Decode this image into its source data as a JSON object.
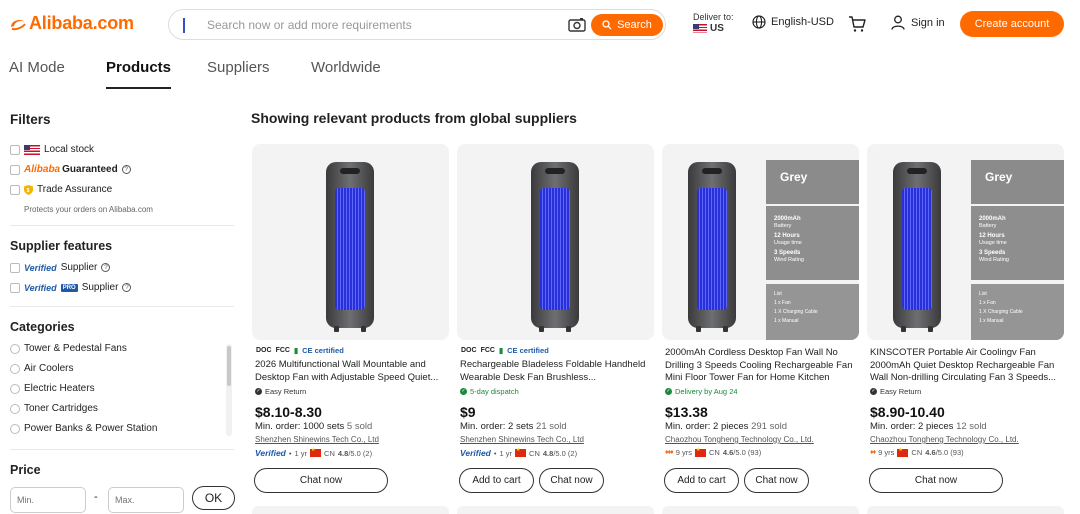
{
  "header": {
    "logo": "Alibaba.com",
    "search_placeholder": "Search now or add more requirements",
    "search_button": "Search",
    "deliver_label": "Deliver to:",
    "deliver_country": "US",
    "language": "English-USD",
    "signin": "Sign in",
    "create_account": "Create account"
  },
  "tabs": [
    "AI Mode",
    "Products",
    "Suppliers",
    "Worldwide"
  ],
  "sidebar": {
    "filters_title": "Filters",
    "local_stock": "Local stock",
    "guaranteed_brand": "Alibaba",
    "guaranteed_word": "Guaranteed",
    "trade_assurance": "Trade Assurance",
    "trade_note": "Protects your orders on Alibaba.com",
    "supplier_features_title": "Supplier features",
    "verified_word": "Verified",
    "pro_word": "PRO",
    "supplier_word": "Supplier",
    "categories_title": "Categories",
    "categories": [
      "Tower & Pedestal Fans",
      "Air Coolers",
      "Electric Heaters",
      "Toner Cartridges",
      "Power Banks & Power Station"
    ],
    "price_title": "Price",
    "min_placeholder": "Min.",
    "max_placeholder": "Max.",
    "dash": "-",
    "ok": "OK"
  },
  "main": {
    "heading": "Showing relevant products from global suppliers"
  },
  "products": [
    {
      "certs": [
        "DOC",
        "FCC",
        "CE certified"
      ],
      "title": "2026 Multifunctional Wall Mountable and Desktop Fan with Adjustable Speed Quiet...",
      "feature": "Easy Return",
      "price": "$8.10-8.30",
      "moq": "Min. order: 1000 sets",
      "sold": "5 sold",
      "supplier": "Shenzhen Shinewins Tech Co., Ltd",
      "badge": "Verified",
      "years": "1 yr",
      "country": "CN",
      "rating": "4.8",
      "rating_total": "/5.0 (2)",
      "buttons": [
        "Chat now"
      ]
    },
    {
      "certs": [
        "DOC",
        "FCC",
        "CE certified"
      ],
      "title": "Rechargeable Bladeless Foldable Handheld Wearable Desk Fan Brushless...",
      "feature": "5-day dispatch",
      "price": "$9",
      "moq": "Min. order: 2 sets",
      "sold": "21 sold",
      "supplier": "Shenzhen Shinewins Tech Co., Ltd",
      "badge": "Verified",
      "years": "1 yr",
      "country": "CN",
      "rating": "4.8",
      "rating_total": "/5.0 (2)",
      "buttons": [
        "Add to cart",
        "Chat now"
      ]
    },
    {
      "title": "2000mAh Cordless Desktop Fan Wall No Drilling 3 Speeds Cooling Rechargeable Fan Mini Floor Tower Fan for Home Kitchen",
      "feature": "Delivery by Aug 24",
      "price": "$13.38",
      "moq": "Min. order: 2 pieces",
      "sold": "291 sold",
      "supplier": "Chaozhou Tongheng Technology Co., Ltd.",
      "years": "9 yrs",
      "country": "CN",
      "rating": "4.6",
      "rating_total": "/5.0 (93)",
      "buttons": [
        "Add to cart",
        "Chat now"
      ]
    },
    {
      "title": "KINSCOTER Portable Air Coolingv Fan 2000mAh Quiet Desktop Rechargeable Fan Wall Non-drilling Circulating Fan 3 Speeds...",
      "feature": "Easy Return",
      "price": "$8.90-10.40",
      "moq": "Min. order: 2 pieces",
      "sold": "12 sold",
      "supplier": "Chaozhou Tongheng Technology Co., Ltd.",
      "years": "9 yrs",
      "country": "CN",
      "rating": "4.6",
      "rating_total": "/5.0 (93)",
      "buttons": [
        "Chat now"
      ]
    }
  ],
  "spec_image": {
    "color": "Grey",
    "battery_val": "2000mAh",
    "battery_lbl": "Battery",
    "hours_val": "12 Hours",
    "hours_lbl": "Usage time",
    "speeds_val": "3 Speeds",
    "speeds_lbl": "Wind Rating",
    "list_title": "List",
    "list_items": [
      "1 x Fan",
      "1 X Charging Cable",
      "1 x Manual"
    ]
  },
  "colors": {
    "brand": "#ff6a00",
    "verified_blue": "#1e5aa8",
    "green": "#1a8a3a"
  }
}
